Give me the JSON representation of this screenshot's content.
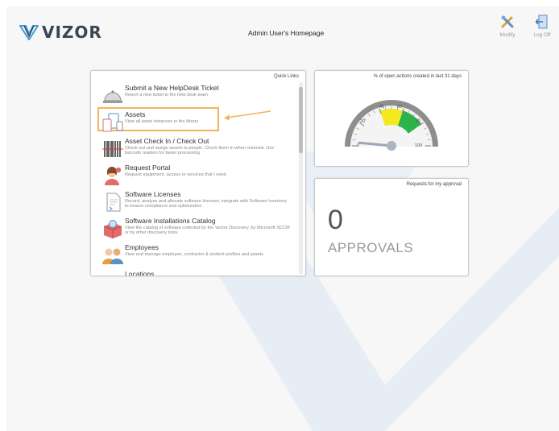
{
  "brand": {
    "name": "VIZOR",
    "color": "#3a4656",
    "accent": "#3aa0d8"
  },
  "header": {
    "title": "Admin User's Homepage",
    "tools": [
      {
        "label": "Modify",
        "icon": "modify-icon"
      },
      {
        "label": "Log Off",
        "icon": "log-off-icon"
      }
    ]
  },
  "quick_links": {
    "title": "Quick Links",
    "highlight_color": "#f0b45a",
    "items": [
      {
        "name": "Submit a New HelpDesk Ticket",
        "desc": "Report a new ticket to the help desk team",
        "icon": "service-bell-icon"
      },
      {
        "name": "Assets",
        "desc": "View all asset instances in the library",
        "icon": "devices-icon",
        "highlighted": true
      },
      {
        "name": "Asset Check In / Check Out",
        "desc": "Check out and assign assets to people. Check them in when returned. Use barcode readers for faster processing",
        "icon": "barcode-icon"
      },
      {
        "name": "Request Portal",
        "desc": "Request equipment, access or services that I need",
        "icon": "support-agent-icon"
      },
      {
        "name": "Software Licenses",
        "desc": "Record, analyze and allocate software licenses; integrate with Software Inventory to ensure compliance and optimization",
        "icon": "license-document-icon"
      },
      {
        "name": "Software Installations Catalog",
        "desc": "View the catalog of software collected by the Vector Discovery, by Microsoft SCCM or by other discovery tools.",
        "icon": "software-box-icon"
      },
      {
        "name": "Employees",
        "desc": "View and manage employee, contractor & student profiles and assets",
        "icon": "people-icon"
      },
      {
        "name": "Locations",
        "desc": "",
        "icon": "location-icon"
      }
    ]
  },
  "gauge": {
    "title": "% of open actions created in last 31 days",
    "min": 0,
    "max": 100,
    "value": 3,
    "ticks": [
      "0",
      "20",
      "40",
      "60",
      "80",
      "100"
    ],
    "bands": [
      {
        "from": 40,
        "to": 60,
        "color": "#f2ea1f"
      },
      {
        "from": 60,
        "to": 80,
        "color": "#2db34a"
      }
    ]
  },
  "approvals": {
    "title": "Requests for my approval",
    "count": "0",
    "label": "APPROVALS"
  }
}
